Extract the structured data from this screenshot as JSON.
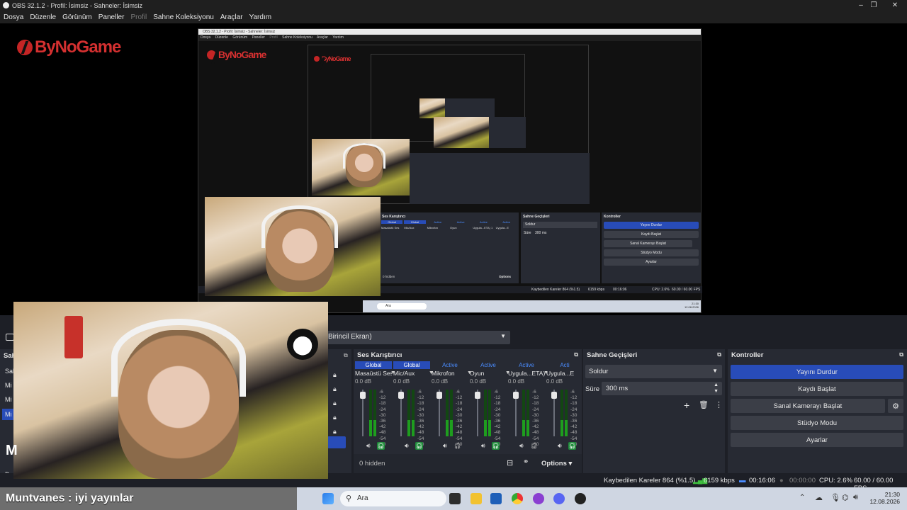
{
  "window": {
    "title": "OBS 32.1.2 - Profil: İsimsiz - Sahneler: İsimsiz",
    "minimize_icon": "minimize-icon",
    "maximize_icon": "maximize-icon",
    "close_icon": "close-icon"
  },
  "menu": [
    "Dosya",
    "Düzenle",
    "Görünüm",
    "Paneller",
    "Profil",
    "Sahne Koleksiyonu",
    "Araçlar",
    "Yardım"
  ],
  "menu_disabled_index": 4,
  "brand": {
    "logo_text": "ByNoGame"
  },
  "sources_toolbar": {
    "display_select": "Birincil Ekran)"
  },
  "mixer": {
    "title": "Ses Karıştırıcı",
    "channels": [
      {
        "status": "Global",
        "name": "Masaüstü Ses",
        "db": "0.0 dB",
        "level": 0.35
      },
      {
        "status": "Global",
        "name": "Mic/Aux",
        "db": "0.0 dB",
        "level": 0.35
      },
      {
        "status": "Active",
        "name": "Mikrofon",
        "db": "0.0 dB",
        "level": 0.35
      },
      {
        "status": "Active",
        "name": "Oyun",
        "db": "0.0 dB",
        "level": 0.35
      },
      {
        "status": "Active",
        "name": "Uygula...ETA) 2",
        "db": "0.0 dB",
        "level": 0.35
      },
      {
        "status": "Acti",
        "name": "Uygula...E",
        "db": "0.0 dB",
        "level": 0.35
      }
    ],
    "scale": [
      "-6",
      "-12",
      "-18",
      "-24",
      "-30",
      "-36",
      "-42",
      "-48",
      "-54",
      "-60"
    ],
    "hidden_label": "0 hidden",
    "options_label": "Options"
  },
  "transitions": {
    "title": "Sahne Geçişleri",
    "selected": "Soldur",
    "duration_label": "Süre",
    "duration_value": "300 ms"
  },
  "controls": {
    "title": "Kontroller",
    "buttons": [
      "Yayını Durdur",
      "Kaydı Başlat",
      "Sanal Kamerayı Başlat",
      "Stüdyo Modu",
      "Ayarlar"
    ]
  },
  "left_dock": {
    "title_fragment": "Sah",
    "items": [
      "Sah",
      "Mi",
      "Mi",
      "Mi"
    ],
    "caption": "Du",
    "big_letter": "M"
  },
  "status_bar": {
    "dropped_frames": "Kaybedilen Kareler 864 (%1.5)",
    "bitrate": "6159 kbps",
    "stream_time": "00:16:06",
    "record_time": "00:00:00",
    "cpu": "CPU: 2.6%",
    "fps": "60.00 / 60.00 FPS"
  },
  "taskbar": {
    "search_placeholder": "Ara",
    "time": "21:30",
    "date": "12.08.2026"
  },
  "chat_overlay": {
    "text": "Muntvanes : iyi yayınlar"
  },
  "colors": {
    "accent": "#284cb8",
    "active_blue": "#4a8cff",
    "brand_red": "#c42525",
    "meter_green": "#1e9e1e"
  },
  "nested": {
    "title": "OBS 32.1.2 - Profil: İsimsiz - Sahneler: İsimsiz",
    "menu": [
      "Dosya",
      "Düzenle",
      "Görünüm",
      "Paneller",
      "Profil",
      "Sahne Koleksiyonu",
      "Araçlar",
      "Yardım"
    ],
    "display_select": "Birincil Ekran)",
    "mixer_title": "Ses Karıştırıcı",
    "transitions_title": "Sahne Geçişleri",
    "controls_title": "Kontroller",
    "transition_selected": "Soldur",
    "duration_label": "Süre",
    "duration_value": "300 ms",
    "buttons": [
      "Yayını Durdur",
      "Kaydı Başlat",
      "Sanal Kamerayı Başlat",
      "Stüdyo Modu",
      "Ayarlar"
    ],
    "hidden_label": "0 hidden",
    "options_label": "Options",
    "status_dropped": "Kaybedilen Kareler 864 (%1.5)",
    "status_bitrate": "6159 kbps",
    "status_time": "00:16:06",
    "status_cpu": "CPU: 2.6%",
    "status_fps": "60.00 / 60.00 FPS",
    "search": "Ara",
    "time": "21:30",
    "date": "12.08.2026",
    "channels": [
      "Masaüstü Ses",
      "Mic/Aux",
      "Mikrofon",
      "Oyun",
      "Uygula...ETA) 1",
      "Uygula...E"
    ],
    "channel_status": [
      "Global",
      "Global",
      "Active",
      "Active",
      "Active",
      "Active"
    ]
  }
}
